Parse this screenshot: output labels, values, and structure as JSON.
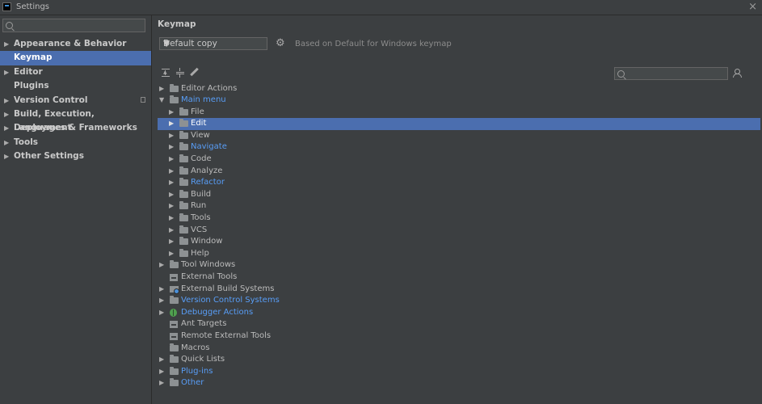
{
  "window": {
    "title": "Settings",
    "icon": "intellij-icon",
    "close": "×"
  },
  "sidebar": {
    "search_placeholder": "",
    "items": [
      {
        "label": "Appearance & Behavior",
        "expandable": true,
        "selected": false
      },
      {
        "label": "Keymap",
        "expandable": false,
        "selected": true
      },
      {
        "label": "Editor",
        "expandable": true,
        "selected": false
      },
      {
        "label": "Plugins",
        "expandable": false,
        "selected": false
      },
      {
        "label": "Version Control",
        "expandable": true,
        "selected": false
      },
      {
        "label": "Build, Execution, Deployment",
        "expandable": true,
        "selected": false
      },
      {
        "label": "Languages & Frameworks",
        "expandable": true,
        "selected": false
      },
      {
        "label": "Tools",
        "expandable": true,
        "selected": false
      },
      {
        "label": "Other Settings",
        "expandable": true,
        "selected": false
      }
    ]
  },
  "main": {
    "title": "Keymap",
    "keymap_select": {
      "value": "Default copy"
    },
    "based_on": "Based on Default for Windows keymap",
    "search_placeholder": "",
    "tree": [
      {
        "label": "Editor Actions",
        "depth": 0,
        "arrow": "▶",
        "icon": "folder-icon",
        "link": false,
        "selected": false
      },
      {
        "label": "Main menu",
        "depth": 0,
        "arrow": "▼",
        "icon": "folder-icon",
        "link": true,
        "selected": false
      },
      {
        "label": "File",
        "depth": 1,
        "arrow": "▶",
        "icon": "folder-icon",
        "link": false,
        "selected": false
      },
      {
        "label": "Edit",
        "depth": 1,
        "arrow": "▶",
        "icon": "folder-icon",
        "link": false,
        "selected": true
      },
      {
        "label": "View",
        "depth": 1,
        "arrow": "▶",
        "icon": "folder-icon",
        "link": false,
        "selected": false
      },
      {
        "label": "Navigate",
        "depth": 1,
        "arrow": "▶",
        "icon": "folder-icon",
        "link": true,
        "selected": false
      },
      {
        "label": "Code",
        "depth": 1,
        "arrow": "▶",
        "icon": "folder-icon",
        "link": false,
        "selected": false
      },
      {
        "label": "Analyze",
        "depth": 1,
        "arrow": "▶",
        "icon": "folder-icon",
        "link": false,
        "selected": false
      },
      {
        "label": "Refactor",
        "depth": 1,
        "arrow": "▶",
        "icon": "folder-icon",
        "link": true,
        "selected": false
      },
      {
        "label": "Build",
        "depth": 1,
        "arrow": "▶",
        "icon": "folder-icon",
        "link": false,
        "selected": false
      },
      {
        "label": "Run",
        "depth": 1,
        "arrow": "▶",
        "icon": "folder-icon",
        "link": false,
        "selected": false
      },
      {
        "label": "Tools",
        "depth": 1,
        "arrow": "▶",
        "icon": "folder-icon",
        "link": false,
        "selected": false
      },
      {
        "label": "VCS",
        "depth": 1,
        "arrow": "▶",
        "icon": "folder-icon",
        "link": false,
        "selected": false
      },
      {
        "label": "Window",
        "depth": 1,
        "arrow": "▶",
        "icon": "folder-icon",
        "link": false,
        "selected": false
      },
      {
        "label": "Help",
        "depth": 1,
        "arrow": "▶",
        "icon": "folder-icon",
        "link": false,
        "selected": false
      },
      {
        "label": "Tool Windows",
        "depth": 0,
        "arrow": "▶",
        "icon": "folder-icon",
        "link": false,
        "selected": false
      },
      {
        "label": "External Tools",
        "depth": 0,
        "arrow": "",
        "icon": "tool-icon",
        "link": false,
        "selected": false
      },
      {
        "label": "External Build Systems",
        "depth": 0,
        "arrow": "▶",
        "icon": "gear-folder-icon",
        "link": false,
        "selected": false
      },
      {
        "label": "Version Control Systems",
        "depth": 0,
        "arrow": "▶",
        "icon": "folder-icon",
        "link": true,
        "selected": false
      },
      {
        "label": "Debugger Actions",
        "depth": 0,
        "arrow": "▶",
        "icon": "bug-icon",
        "link": true,
        "selected": false
      },
      {
        "label": "Ant Targets",
        "depth": 0,
        "arrow": "",
        "icon": "tool-icon",
        "link": false,
        "selected": false
      },
      {
        "label": "Remote External Tools",
        "depth": 0,
        "arrow": "",
        "icon": "tool-icon",
        "link": false,
        "selected": false
      },
      {
        "label": "Macros",
        "depth": 0,
        "arrow": "",
        "icon": "folder-icon",
        "link": false,
        "selected": false
      },
      {
        "label": "Quick Lists",
        "depth": 0,
        "arrow": "▶",
        "icon": "folder-icon",
        "link": false,
        "selected": false
      },
      {
        "label": "Plug-ins",
        "depth": 0,
        "arrow": "▶",
        "icon": "folder-icon",
        "link": true,
        "selected": false
      },
      {
        "label": "Other",
        "depth": 0,
        "arrow": "▶",
        "icon": "folder-icon",
        "link": true,
        "selected": false
      }
    ]
  },
  "colors": {
    "background": "#3c3f41",
    "selection": "#4b6eaf",
    "link": "#589df6",
    "text": "#bbbbbb"
  }
}
